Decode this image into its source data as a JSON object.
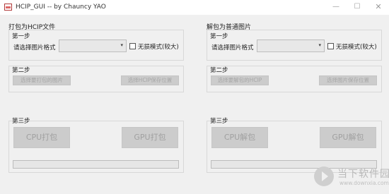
{
  "window": {
    "title": "HCIP_GUI -- by Chauncy YAO",
    "minimize_glyph": "—",
    "maximize_glyph": "☐",
    "close_glyph": "✕"
  },
  "left_panel": {
    "title": "打包为HCIP文件",
    "step1": {
      "label": "第一步",
      "format_label": "请选择图片格式",
      "format_value": "",
      "lossless_label": "无损模式(较大)",
      "lossless_checked": false
    },
    "step2": {
      "label": "第二步",
      "select_source_button": "选择要打包的图片",
      "select_save_button": "选择HCIP保存位置"
    },
    "step3": {
      "label": "第三步",
      "cpu_button": "CPU打包",
      "gpu_button": "GPU打包",
      "progress": 0
    }
  },
  "right_panel": {
    "title": "解包为普通图片",
    "step1": {
      "label": "第一步",
      "format_label": "请选择图片格式",
      "format_value": "",
      "lossless_label": "无损模式(较大)",
      "lossless_checked": false
    },
    "step2": {
      "label": "第二步",
      "select_source_button": "选择要解包的HCIP",
      "select_save_button": "选择图片保存位置"
    },
    "step3": {
      "label": "第三步",
      "cpu_button": "CPU解包",
      "gpu_button": "GPU解包",
      "progress": 0
    }
  },
  "watermark": {
    "name": "当下软件园",
    "url": "www.downxia.com"
  },
  "colors": {
    "window_bg": "#f0f0f0",
    "disabled_button_bg": "#cccccc",
    "disabled_text": "#a0a0a0"
  }
}
